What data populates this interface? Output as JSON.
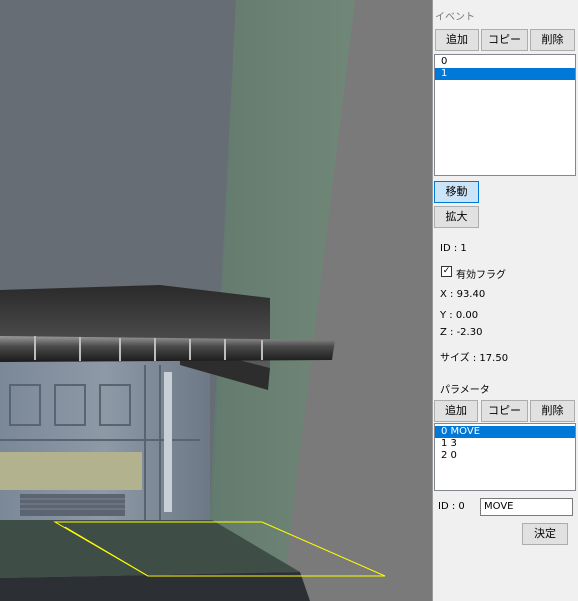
{
  "event_panel": {
    "title": "イベント",
    "add_label": "追加",
    "copy_label": "コピー",
    "delete_label": "削除",
    "items": [
      "0",
      "1"
    ],
    "selected_index": 1
  },
  "action_buttons": {
    "move_label": "移動",
    "scale_label": "拡大"
  },
  "properties": {
    "id_text": "ID : 1",
    "enabled_flag_label": "有効フラグ",
    "enabled_flag_checked": true,
    "x_text": "X : 93.40",
    "y_text": "Y : 0.00",
    "z_text": "Z : -2.30",
    "size_text": "サイズ : 17.50"
  },
  "param_panel": {
    "title": "パラメータ",
    "add_label": "追加",
    "copy_label": "コピー",
    "delete_label": "削除",
    "items": [
      "0 MOVE",
      "1 3",
      "2 0"
    ],
    "selected_index": 0
  },
  "edit": {
    "id_label": "ID : 0",
    "value": "MOVE",
    "ok_label": "決定"
  },
  "colors": {
    "viewport_bg": "#7a7a7a",
    "selection": "#0078d7",
    "trigger_volume": "#5a8a6a",
    "wireframe": "#ffff00"
  }
}
